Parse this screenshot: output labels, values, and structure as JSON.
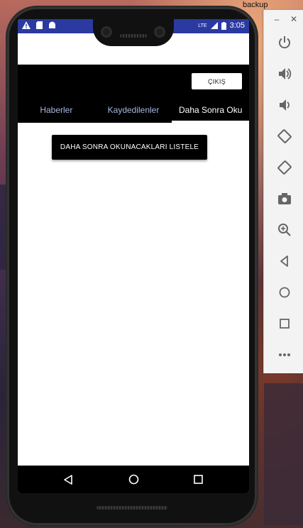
{
  "window": {
    "title_fragment": "backup"
  },
  "statusbar": {
    "time": "3:05",
    "network": "LTE"
  },
  "toolbar": {
    "exit_label": "ÇIKIŞ"
  },
  "tabs": [
    {
      "label": "Haberler",
      "active": false
    },
    {
      "label": "Kaydedilenler",
      "active": false
    },
    {
      "label": "Daha Sonra Oku",
      "active": true
    }
  ],
  "content": {
    "list_button_label": "DAHA SONRA OKUNACAKLARI LISTELE"
  },
  "navbar": {
    "icons": [
      "back-icon",
      "home-icon",
      "recents-icon"
    ]
  },
  "emulator_panel": {
    "icons": [
      "power-icon",
      "volume-up-icon",
      "volume-down-icon",
      "rotate-left-icon",
      "rotate-right-icon",
      "camera-icon",
      "zoom-icon",
      "back-icon",
      "home-icon",
      "overview-icon",
      "more-icon"
    ]
  },
  "colors": {
    "statusbar": "#2b3aa1",
    "tab_inactive": "#a7b8e0",
    "tab_active": "#ffffff",
    "appbar": "#000000"
  }
}
